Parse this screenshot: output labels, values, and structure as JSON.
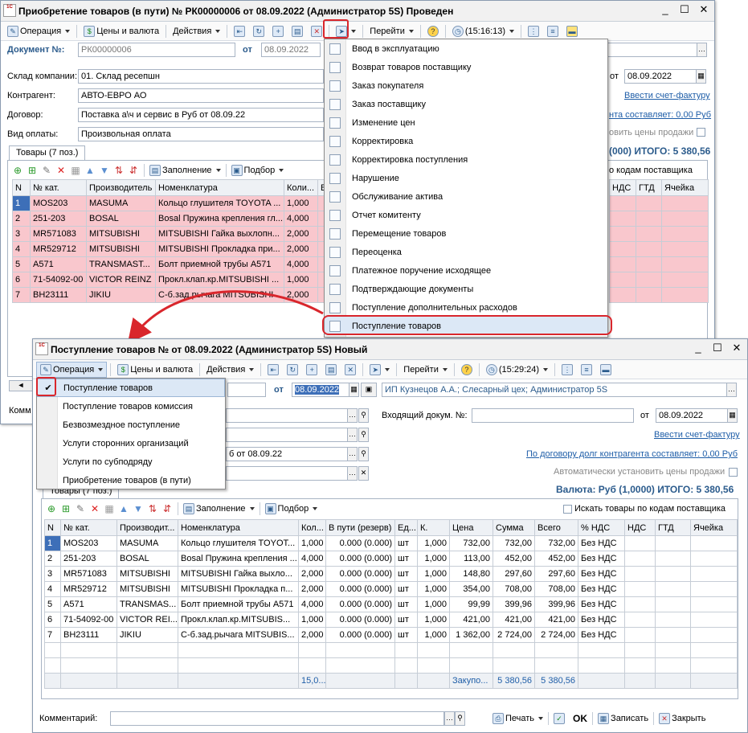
{
  "win1": {
    "title": "Приобретение товаров (в пути) № РК00000006 от 08.09.2022 (Администратор 5S) Проведен",
    "toolbar": {
      "operation": "Операция",
      "prices": "Цены и валюта",
      "actions": "Действия",
      "goto": "Перейти",
      "time": "(15:16:13)"
    },
    "doc_no_label": "Документ №:",
    "doc_no": "РК00000006",
    "from_label": "от",
    "date": "08.09.2022",
    "warehouse_label": "Склад компании:",
    "warehouse": "01. Склад ресепшн",
    "counterparty_label": "Контрагент:",
    "counterparty": "АВТО-ЕВРО АО",
    "contract_label": "Договор:",
    "contract": "Поставка а\\ч и сервис в Руб от 08.09.22",
    "payment_label": "Вид оплаты:",
    "payment": "Произвольная оплата",
    "right_from_label": "от",
    "right_date": "08.09.2022",
    "invoice_link": "Ввести счет-фактуру",
    "debt_link": "нта составляет: 0,00 Руб",
    "auto_prices": "овить цены продажи",
    "total": "(000) ИТОГО: 5 380,56",
    "tab_goods": "Товары (7 поз.)",
    "fill": "Заполнение",
    "select": "Подбор",
    "search_supplier": "о кодам поставщика",
    "cols": [
      "N",
      "№ кат.",
      "Производитель",
      "Номенклатура",
      "Коли...",
      "В",
      "НДС",
      "ГТД",
      "Ячейка"
    ],
    "rows": [
      {
        "n": "1",
        "cat": "MOS203",
        "mfr": "MASUMA",
        "name": "Кольцо глушителя TOYOTA ...",
        "qty": "1,000"
      },
      {
        "n": "2",
        "cat": "251-203",
        "mfr": "BOSAL",
        "name": "Bosal Пружина крепления гл...",
        "qty": "4,000"
      },
      {
        "n": "3",
        "cat": "MR571083",
        "mfr": "MITSUBISHI",
        "name": "MITSUBISHI Гайка выхлопн...",
        "qty": "2,000"
      },
      {
        "n": "4",
        "cat": "MR529712",
        "mfr": "MITSUBISHI",
        "name": "MITSUBISHI Прокладка при...",
        "qty": "2,000"
      },
      {
        "n": "5",
        "cat": "A571",
        "mfr": "TRANSMAST...",
        "name": "Болт приемной трубы А571",
        "qty": "4,000"
      },
      {
        "n": "6",
        "cat": "71-54092-00",
        "mfr": "VICTOR REINZ",
        "name": "Прокл.клап.кр.MITSUBISHI ...",
        "qty": "1,000"
      },
      {
        "n": "7",
        "cat": "BH23111",
        "mfr": "JIKIU",
        "name": "С-б.зад.рычага MITSUBISHI ...",
        "qty": "2,000"
      }
    ],
    "comment_label": "Комм"
  },
  "menu1": {
    "items": [
      "Ввод в эксплуатацию",
      "Возврат товаров поставщику",
      "Заказ покупателя",
      "Заказ поставщику",
      "Изменение цен",
      "Корректировка",
      "Корректировка поступления",
      "Нарушение",
      "Обслуживание актива",
      "Отчет комитенту",
      "Перемещение товаров",
      "Переоценка",
      "Платежное поручение исходящее",
      "Подтверждающие документы",
      "Поступление дополнительных расходов",
      "Поступление товаров"
    ]
  },
  "win2": {
    "title": "Поступление товаров №  от 08.09.2022 (Администратор 5S) Новый",
    "toolbar": {
      "operation": "Операция",
      "prices": "Цены и валюта",
      "actions": "Действия",
      "goto": "Перейти",
      "time": "(15:29:24)"
    },
    "from_label": "от",
    "date": "08.09.2022",
    "org": "ИП Кузнецов А.А.; Слесарный цех; Администратор 5S",
    "incoming_label": "Входящий докум. №:",
    "incoming_from": "от",
    "incoming_date": "08.09.2022",
    "invoice_link": "Ввести счет-фактуру",
    "debt_link": "По договору долг контрагента составляет: 0,00 Руб",
    "auto_prices": "Автоматически установить цены продажи",
    "contract_tail": "б от 08.09.22",
    "total": "Валюта: Руб (1,0000) ИТОГО: 5 380,56",
    "tab_goods": "Товары (7 поз.)",
    "fill": "Заполнение",
    "select": "Подбор",
    "search_supplier": "Искать товары по кодам поставщика",
    "cols": [
      "N",
      "№ кат.",
      "Производит...",
      "Номенклатура",
      "Кол...",
      "В пути (резерв)",
      "Ед...",
      "К.",
      "Цена",
      "Сумма",
      "Всего",
      "% НДС",
      "НДС",
      "ГТД",
      "Ячейка"
    ],
    "rows": [
      {
        "n": "1",
        "cat": "MOS203",
        "mfr": "MASUMA",
        "name": "Кольцо глушителя TOYOT...",
        "qty": "1,000",
        "res": "0.000 (0.000)",
        "unit": "шт",
        "k": "1,000",
        "price": "732,00",
        "sum": "732,00",
        "total": "732,00",
        "vat": "Без НДС"
      },
      {
        "n": "2",
        "cat": "251-203",
        "mfr": "BOSAL",
        "name": "Bosal Пружина крепления ...",
        "qty": "4,000",
        "res": "0.000 (0.000)",
        "unit": "шт",
        "k": "1,000",
        "price": "113,00",
        "sum": "452,00",
        "total": "452,00",
        "vat": "Без НДС"
      },
      {
        "n": "3",
        "cat": "MR571083",
        "mfr": "MITSUBISHI",
        "name": "MITSUBISHI Гайка выхло...",
        "qty": "2,000",
        "res": "0.000 (0.000)",
        "unit": "шт",
        "k": "1,000",
        "price": "148,80",
        "sum": "297,60",
        "total": "297,60",
        "vat": "Без НДС"
      },
      {
        "n": "4",
        "cat": "MR529712",
        "mfr": "MITSUBISHI",
        "name": "MITSUBISHI Прокладка п...",
        "qty": "2,000",
        "res": "0.000 (0.000)",
        "unit": "шт",
        "k": "1,000",
        "price": "354,00",
        "sum": "708,00",
        "total": "708,00",
        "vat": "Без НДС"
      },
      {
        "n": "5",
        "cat": "A571",
        "mfr": "TRANSMAS...",
        "name": "Болт приемной трубы А571",
        "qty": "4,000",
        "res": "0.000 (0.000)",
        "unit": "шт",
        "k": "1,000",
        "price": "99,99",
        "sum": "399,96",
        "total": "399,96",
        "vat": "Без НДС"
      },
      {
        "n": "6",
        "cat": "71-54092-00",
        "mfr": "VICTOR REI...",
        "name": "Прокл.клап.кр.MITSUBIS...",
        "qty": "1,000",
        "res": "0.000 (0.000)",
        "unit": "шт",
        "k": "1,000",
        "price": "421,00",
        "sum": "421,00",
        "total": "421,00",
        "vat": "Без НДС"
      },
      {
        "n": "7",
        "cat": "BH23111",
        "mfr": "JIKIU",
        "name": "С-б.зад.рычага MITSUBIS...",
        "qty": "2,000",
        "res": "0.000 (0.000)",
        "unit": "шт",
        "k": "1,000",
        "price": "1 362,00",
        "sum": "2 724,00",
        "total": "2 724,00",
        "vat": "Без НДС"
      }
    ],
    "footer": {
      "qty": "15,0...",
      "purchase": "Закупо...",
      "sum": "5 380,56",
      "total": "5 380,56"
    },
    "comment_label": "Комментарий:",
    "print": "Печать",
    "ok": "OK",
    "save": "Записать",
    "close": "Закрыть"
  },
  "menu2": {
    "items": [
      "Поступление товаров",
      "Поступление товаров комиссия",
      "Безвозмездное поступление",
      "Услуги сторонних организаций",
      "Услуги по субподряду",
      "Приобретение товаров (в пути)"
    ]
  },
  "colors": {
    "highlight_red": "#d9262c",
    "row_pink": "#f9c7cd",
    "link_blue": "#1f5ea8"
  }
}
